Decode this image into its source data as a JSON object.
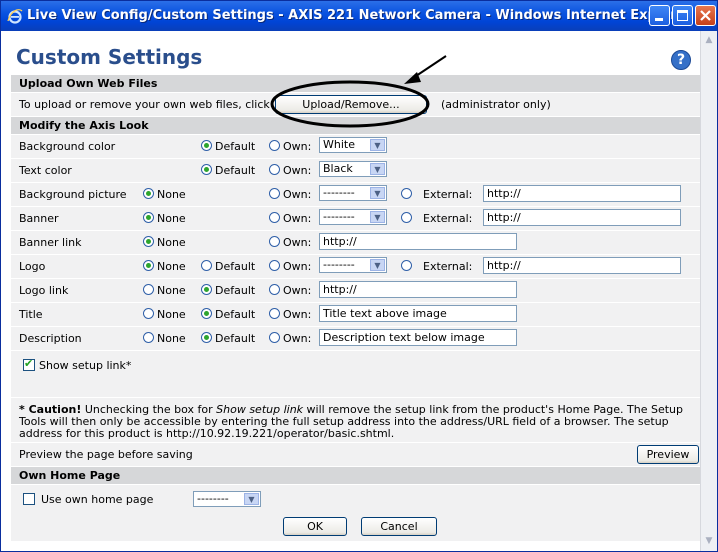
{
  "window": {
    "title": "Live View Config/Custom Settings - AXIS 221 Network Camera - Windows Internet Explorer"
  },
  "page": {
    "heading": "Custom Settings",
    "help_glyph": "?"
  },
  "upload": {
    "section": "Upload Own Web Files",
    "text": "To upload or remove your own web files, click",
    "button": "Upload/Remove...",
    "note": "(administrator only)"
  },
  "look": {
    "section": "Modify the Axis Look",
    "none": "None",
    "default": "Default",
    "own": "Own:",
    "external": "External:",
    "rows": {
      "bgcolor": {
        "label": "Background color",
        "value": "White"
      },
      "textcolor": {
        "label": "Text color",
        "value": "Black"
      },
      "bgpicture": {
        "label": "Background picture",
        "value": "--------",
        "external": "http://"
      },
      "banner": {
        "label": "Banner",
        "value": "--------",
        "external": "http://"
      },
      "bannerlink": {
        "label": "Banner link",
        "value": "http://"
      },
      "logo": {
        "label": "Logo",
        "value": "--------",
        "external": "http://"
      },
      "logolink": {
        "label": "Logo link",
        "value": "http://"
      },
      "title": {
        "label": "Title",
        "value": "Title text above image"
      },
      "description": {
        "label": "Description",
        "value": "Description text below image"
      }
    }
  },
  "setup_link": {
    "label": "Show setup link*",
    "checked": true
  },
  "caution": {
    "strong": "* Caution!",
    "part1": " Unchecking the box for ",
    "em": "Show setup link",
    "part2": " will remove the setup link from the product's Home Page. The Setup Tools will then only be accessible by entering the full setup address into the address/URL field of a browser. The setup address for this product is http://10.92.19.221/operator/basic.shtml."
  },
  "preview": {
    "text": "Preview the page before saving",
    "button": "Preview"
  },
  "home": {
    "section": "Own Home Page",
    "label": "Use own home page",
    "value": "--------",
    "checked": false
  },
  "buttons": {
    "ok": "OK",
    "cancel": "Cancel"
  },
  "colors": {
    "titlebar": "#0a53e0",
    "heading": "#2a4e8c",
    "section_bg": "#d6d7d9",
    "row_bg": "#f1f1f2",
    "radio_dot": "#2ea52e"
  }
}
